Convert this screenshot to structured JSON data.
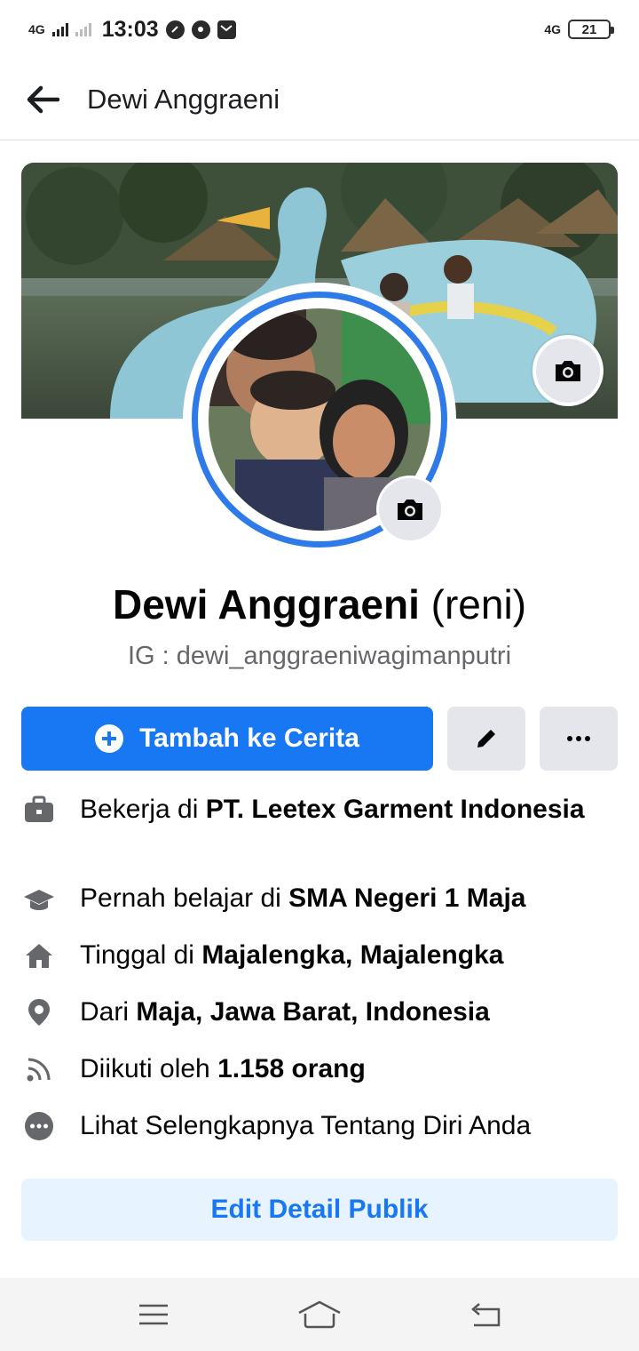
{
  "status_bar": {
    "network_left": "4G",
    "time": "13:03",
    "network_right": "4G",
    "battery": "21"
  },
  "header": {
    "title": "Dewi Anggraeni"
  },
  "profile": {
    "name": "Dewi Anggraeni",
    "alternate_name": "(reni)",
    "bio": "IG : dewi_anggraeniwagimanputri"
  },
  "actions": {
    "add_to_story": "Tambah ke Cerita"
  },
  "details": [
    {
      "icon": "briefcase-icon",
      "prefix": "Bekerja di ",
      "value": "PT. Leetex Garment Indonesia"
    },
    {
      "icon": "graduation-cap-icon",
      "prefix": "Pernah belajar di ",
      "value": "SMA Negeri 1 Maja"
    },
    {
      "icon": "home-icon",
      "prefix": "Tinggal di ",
      "value": "Majalengka, Majalengka"
    },
    {
      "icon": "location-pin-icon",
      "prefix": "Dari ",
      "value": "Maja, Jawa Barat, Indonesia"
    },
    {
      "icon": "rss-icon",
      "prefix": "Diikuti oleh ",
      "value": "1.158 orang"
    },
    {
      "icon": "more-circle-icon",
      "prefix": "Lihat Selengkapnya Tentang Diri Anda",
      "value": ""
    }
  ],
  "edit_details_label": "Edit Detail Publik",
  "colors": {
    "primary": "#1877f2",
    "light_blue": "#e7f3ff",
    "grey_button": "#e4e6eb",
    "avatar_ring": "#2d7ae8"
  }
}
